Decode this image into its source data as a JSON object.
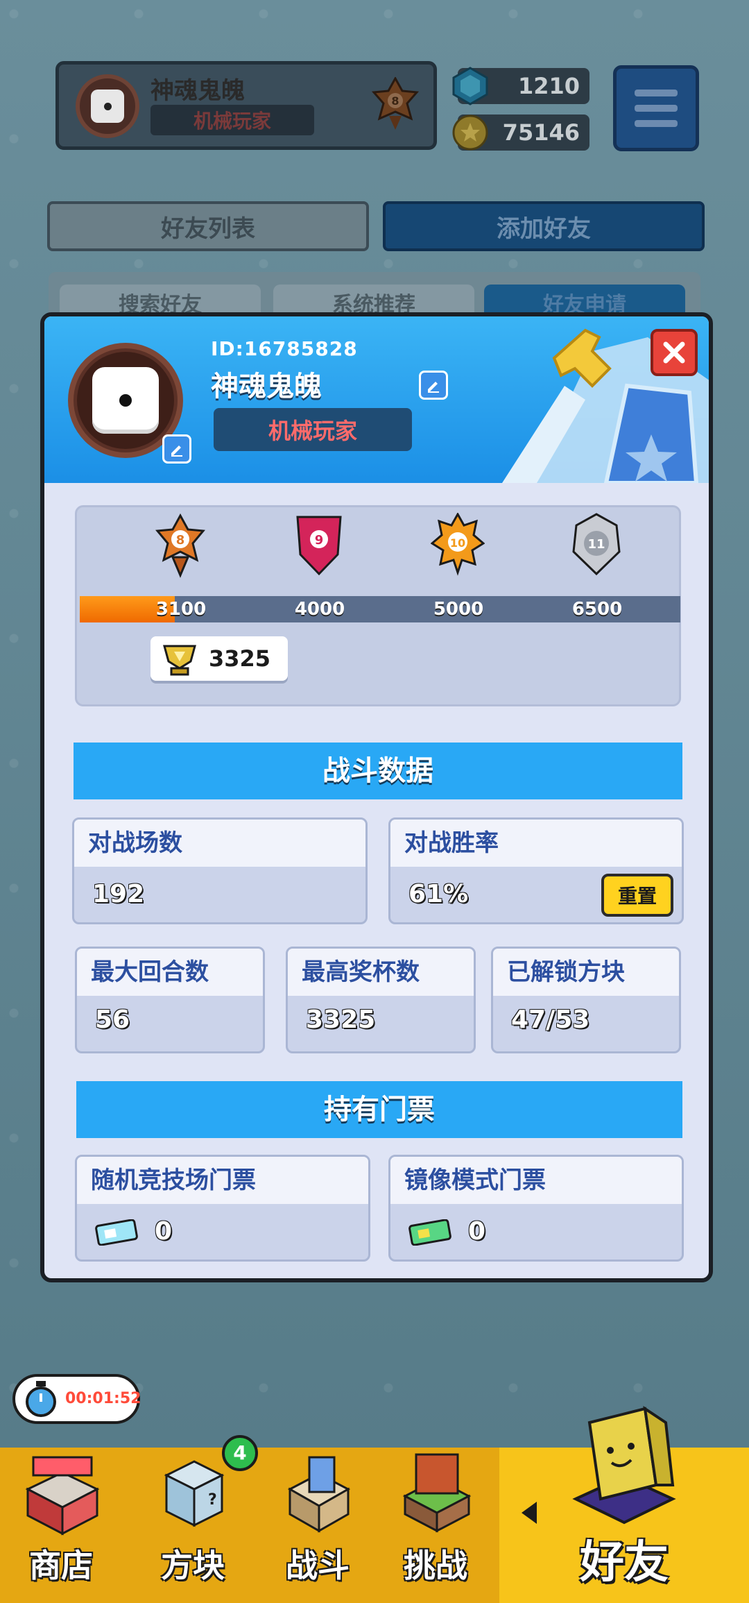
{
  "top_bar": {
    "player_name": "神魂鬼魄",
    "player_title": "机械玩家",
    "rank_level": "8",
    "gems": "1210",
    "coins": "75146"
  },
  "tabs": {
    "friends_list": "好友列表",
    "add_friend": "添加好友"
  },
  "subtabs": [
    "搜索好友",
    "系统推荐",
    "好友申请"
  ],
  "profile": {
    "id_text": "ID:16785828",
    "name": "神魂鬼魄",
    "title": "机械玩家"
  },
  "rank": {
    "levels": [
      {
        "level": "8",
        "threshold": "3100",
        "color": "#e07826"
      },
      {
        "level": "9",
        "threshold": "4000",
        "color": "#d4245a"
      },
      {
        "level": "10",
        "threshold": "5000",
        "color": "#f39a1a"
      },
      {
        "level": "11",
        "threshold": "6500",
        "color": "#b9bdc6"
      }
    ],
    "current_trophies": "3325",
    "progress_fraction": 0.158
  },
  "battle": {
    "header": "战斗数据",
    "matches_label": "对战场数",
    "matches_value": "192",
    "winrate_label": "对战胜率",
    "winrate_value": "61%",
    "reset_label": "重置",
    "max_rounds_label": "最大回合数",
    "max_rounds_value": "56",
    "max_trophies_label": "最高奖杯数",
    "max_trophies_value": "3325",
    "unlocked_blocks_label": "已解锁方块",
    "unlocked_blocks_value": "47/53"
  },
  "tickets": {
    "header": "持有门票",
    "arena_label": "随机竞技场门票",
    "arena_value": "0",
    "mirror_label": "镜像模式门票",
    "mirror_value": "0"
  },
  "timer": "00:01:52",
  "nav": {
    "shop": "商店",
    "blocks": "方块",
    "blocks_badge": "4",
    "battle": "战斗",
    "challenge": "挑战",
    "friends": "好友"
  },
  "colors": {
    "accent_blue": "#29a8f5",
    "header_blue": "#1b8fe6",
    "nav_gold": "#e5a712",
    "progress_orange": "#ef6a00",
    "close_red": "#e8433a"
  }
}
